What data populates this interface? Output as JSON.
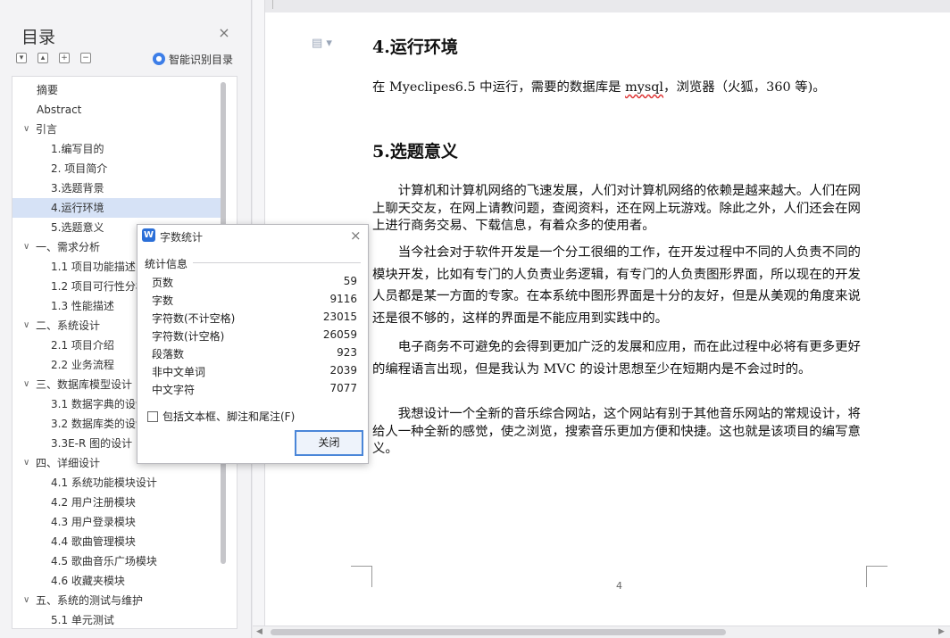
{
  "toc": {
    "title": "目录",
    "smart_label": "智能识别目录",
    "items": [
      {
        "label": "摘要",
        "level": 0,
        "expandable": false,
        "selected": false
      },
      {
        "label": "Abstract",
        "level": 0,
        "expandable": false,
        "selected": false
      },
      {
        "label": "引言",
        "level": 0,
        "expandable": true,
        "selected": false
      },
      {
        "label": "1.编写目的",
        "level": 1,
        "expandable": false,
        "selected": false
      },
      {
        "label": "2. 项目简介",
        "level": 1,
        "expandable": false,
        "selected": false
      },
      {
        "label": "3.选题背景",
        "level": 1,
        "expandable": false,
        "selected": false
      },
      {
        "label": "4.运行环境",
        "level": 1,
        "expandable": false,
        "selected": true
      },
      {
        "label": "5.选题意义",
        "level": 1,
        "expandable": false,
        "selected": false
      },
      {
        "label": "一、需求分析",
        "level": 0,
        "expandable": true,
        "selected": false
      },
      {
        "label": "1.1 项目功能描述",
        "level": 1,
        "expandable": false,
        "selected": false
      },
      {
        "label": "1.2 项目可行性分析",
        "level": 1,
        "expandable": false,
        "selected": false
      },
      {
        "label": "1.3 性能描述",
        "level": 1,
        "expandable": false,
        "selected": false
      },
      {
        "label": "二、系统设计",
        "level": 0,
        "expandable": true,
        "selected": false
      },
      {
        "label": "2.1 项目介绍",
        "level": 1,
        "expandable": false,
        "selected": false
      },
      {
        "label": "2.2 业务流程",
        "level": 1,
        "expandable": false,
        "selected": false
      },
      {
        "label": "三、数据库模型设计",
        "level": 0,
        "expandable": true,
        "selected": false
      },
      {
        "label": "3.1 数据字典的设计",
        "level": 1,
        "expandable": false,
        "selected": false
      },
      {
        "label": "3.2 数据库类的设计",
        "level": 1,
        "expandable": false,
        "selected": false
      },
      {
        "label": "3.3E-R 图的设计",
        "level": 1,
        "expandable": false,
        "selected": false
      },
      {
        "label": "四、详细设计",
        "level": 0,
        "expandable": true,
        "selected": false
      },
      {
        "label": "4.1 系统功能模块设计",
        "level": 1,
        "expandable": false,
        "selected": false
      },
      {
        "label": "4.2 用户注册模块",
        "level": 1,
        "expandable": false,
        "selected": false
      },
      {
        "label": "4.3 用户登录模块",
        "level": 1,
        "expandable": false,
        "selected": false
      },
      {
        "label": "4.4 歌曲管理模块",
        "level": 1,
        "expandable": false,
        "selected": false
      },
      {
        "label": "4.5 歌曲音乐广场模块",
        "level": 1,
        "expandable": false,
        "selected": false
      },
      {
        "label": "4.6 收藏夹模块",
        "level": 1,
        "expandable": false,
        "selected": false
      },
      {
        "label": "五、系统的测试与维护",
        "level": 0,
        "expandable": true,
        "selected": false
      },
      {
        "label": "5.1 单元测试",
        "level": 1,
        "expandable": false,
        "selected": false
      }
    ]
  },
  "document": {
    "heading1": "4.运行环境",
    "env_text_pre": "在 Myeclipes6.5 中运行，需要的数据库是 ",
    "env_text_squig": "mysql",
    "env_text_post": "，浏览器（火狐，360 等)。",
    "heading2": "5.选题意义",
    "para1": "计算机和计算机网络的飞速发展，人们对计算机网络的依赖是越来越大。人们在网上聊天交友，在网上请教问题，查阅资料，还在网上玩游戏。除此之外，人们还会在网上进行商务交易、下载信息，有着众多的使用者。",
    "para2": "当今社会对于软件开发是一个分工很细的工作，在开发过程中不同的人负责不同的模块开发，比如有专门的人负责业务逻辑，有专门的人负责图形界面，所以现在的开发人员都是某一方面的专家。在本系统中图形界面是十分的友好，但是从美观的角度来说还是很不够的，这样的界面是不能应用到实践中的。",
    "para3": "电子商务不可避免的会得到更加广泛的发展和应用，而在此过程中必将有更多更好的编程语言出现，但是我认为 MVC 的设计思想至少在短期内是不会过时的。",
    "para4": "我想设计一个全新的音乐综合网站，这个网站有别于其他音乐网站的常规设计，将给人一种全新的感觉，使之浏览，搜索音乐更加方便和快捷。这也就是该项目的编写意义。",
    "page_number": "4"
  },
  "dialog": {
    "title": "字数统计",
    "group_label": "统计信息",
    "stats": [
      {
        "label": "页数",
        "value": "59"
      },
      {
        "label": "字数",
        "value": "9116"
      },
      {
        "label": "字符数(不计空格)",
        "value": "23015"
      },
      {
        "label": "字符数(计空格)",
        "value": "26059"
      },
      {
        "label": "段落数",
        "value": "923"
      },
      {
        "label": "非中文单词",
        "value": "2039"
      },
      {
        "label": "中文字符",
        "value": "7077"
      }
    ],
    "checkbox_label": "包括文本框、脚注和尾注(F)",
    "checkbox_checked": false,
    "close_label": "关闭"
  }
}
